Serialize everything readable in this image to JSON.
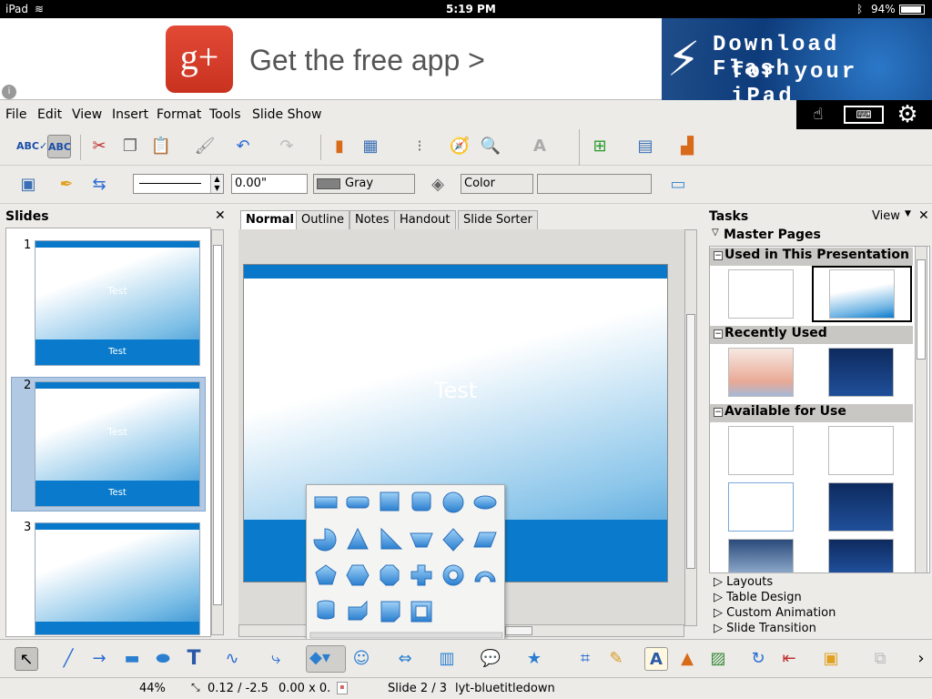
{
  "status_bar": {
    "device": "iPad",
    "time": "5:19 PM",
    "battery": "94%"
  },
  "ad": {
    "left_text": "Get the free app >",
    "right_line1": "Download Flash",
    "right_line2": "for your iPad",
    "gplus": "g+"
  },
  "menu": [
    "File",
    "Edit",
    "View",
    "Insert",
    "Format",
    "Tools",
    "Slide Show"
  ],
  "toolbar2": {
    "line_width": "0.00\"",
    "area_color": "Gray",
    "color_mode": "Color"
  },
  "slides_pane": {
    "title": "Slides",
    "slides": [
      {
        "number": "1",
        "title": "Test",
        "footer": "Test"
      },
      {
        "number": "2",
        "title": "Test",
        "footer": "Test"
      },
      {
        "number": "3"
      }
    ]
  },
  "view_tabs": [
    "Normal",
    "Outline",
    "Notes",
    "Handout",
    "Slide Sorter"
  ],
  "slide": {
    "title": "Test"
  },
  "tasks_pane": {
    "title": "Tasks",
    "view_label": "View",
    "master_pages": "Master Pages",
    "used": "Used in This Presentation",
    "recent": "Recently Used",
    "available": "Available for Use",
    "expanders": [
      "Layouts",
      "Table Design",
      "Custom Animation",
      "Slide Transition"
    ]
  },
  "status_line": {
    "zoom": "44%",
    "position": "0.12 / -2.5",
    "size": "0.00 x 0.",
    "slide": "Slide 2 / 3",
    "layout": "lyt-bluetitledown"
  },
  "colors": {
    "accent": "#0a7bcc",
    "chrome": "#ecebe8"
  }
}
